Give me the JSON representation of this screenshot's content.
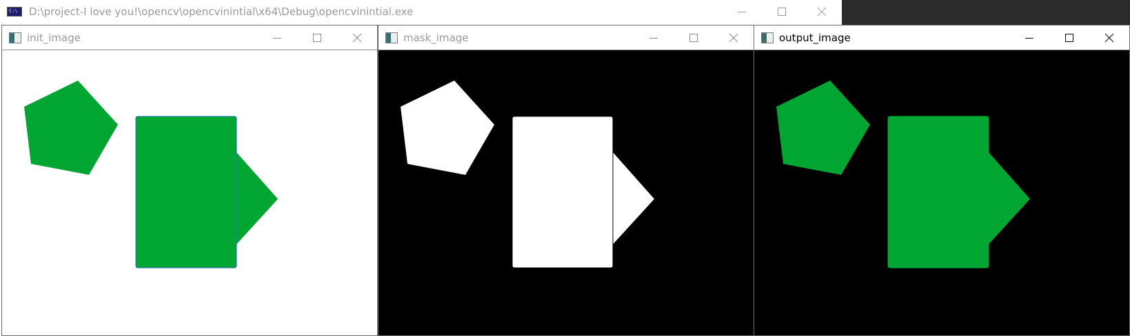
{
  "console": {
    "title": "D:\\project-I love you!\\opencv\\opencvinintial\\x64\\Debug\\opencvinintial.exe",
    "icon": "console-app-icon"
  },
  "windows": [
    {
      "title": "init_image",
      "active": false,
      "background": "#ffffff",
      "shape_fill": "#00a532",
      "rect_stroke": "#2f6fd0"
    },
    {
      "title": "mask_image",
      "active": false,
      "background": "#000000",
      "shape_fill": "#ffffff",
      "rect_stroke": "#000000"
    },
    {
      "title": "output_image",
      "active": true,
      "background": "#000000",
      "shape_fill": "#00a532",
      "rect_stroke": "#00a532"
    }
  ],
  "controls": {
    "minimize_icon": "minimize-icon",
    "maximize_icon": "maximize-icon",
    "close_icon": "close-icon"
  }
}
